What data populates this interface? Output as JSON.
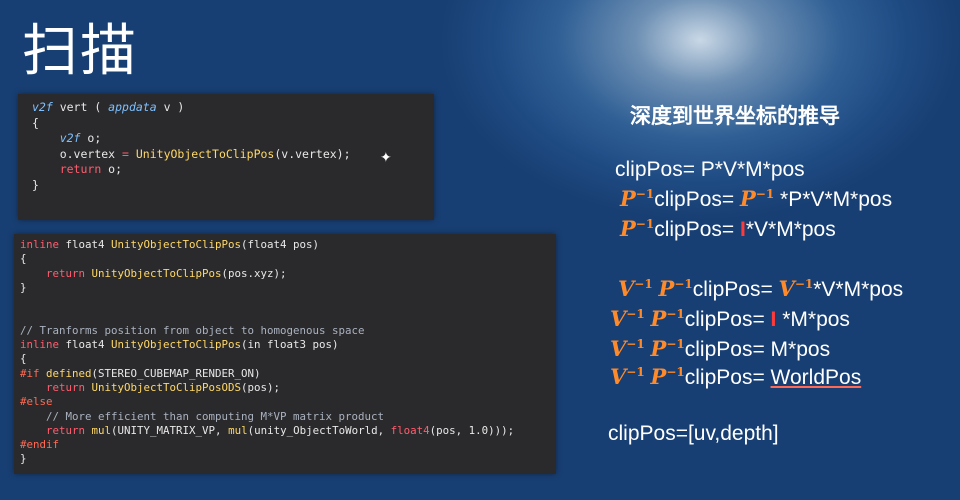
{
  "slide": {
    "title": "扫描",
    "heading": "深度到世界坐标的推导"
  },
  "code1": {
    "l1_type": "v2f",
    "l1_name": " vert ( ",
    "l1_param": "appdata",
    "l1_end": " v )",
    "l2": "{",
    "l3_type": "v2f",
    "l3_rest": " o;",
    "l4_a": "o.vertex ",
    "l4_eq": "=",
    "l4_fn": " UnityObjectToClipPos",
    "l4_end": "(v.vertex);",
    "l5_kw": "return",
    "l5_rest": " o;",
    "l6": "}"
  },
  "code2": {
    "a1_kw": "inline",
    "a1_rest": " float4 ",
    "a1_fn": "UnityObjectToClipPos",
    "a1_end": "(float4 pos)",
    "a2": "{",
    "a3_kw": "return",
    "a3_fn": " UnityObjectToClipPos",
    "a3_end": "(pos.xyz);",
    "a4": "}",
    "b1": "// Tranforms position from object to homogenous space",
    "b2_kw": "inline",
    "b2_rest": " float4 ",
    "b2_fn": "UnityObjectToClipPos",
    "b2_end": "(in float3 pos)",
    "b3": "{",
    "b4_pp": "#if",
    "b4_fn": " defined",
    "b4_end": "(STEREO_CUBEMAP_RENDER_ON)",
    "b5_kw": "return",
    "b5_fn": " UnityObjectToClipPosODS",
    "b5_end": "(pos);",
    "b6_pp": "#else",
    "b7": "// More efficient than computing M*VP matrix product",
    "b8_kw": "return",
    "b8_fn": " mul",
    "b8_mid1": "(UNITY_MATRIX_VP, ",
    "b8_fn2": "mul",
    "b8_mid2": "(unity_ObjectToWorld, ",
    "b8_kw2": "float4",
    "b8_end": "(pos, 1.0)));",
    "b9_pp": "#endif",
    "b10": "}"
  },
  "equations": {
    "e1": "clipPos= P*V*M*pos",
    "p_inv": "P",
    "v_inv": "V",
    "exp": "−1",
    "clip": "clipPos= ",
    "e2_rest": " *P*V*M*pos",
    "e3_mark": "I",
    "e3_rest": "*V*M*pos",
    "e4_rest": "*V*M*pos",
    "e5_mark": "I",
    "e5_rest": " *M*pos",
    "e6_rest": "M*pos",
    "e7_rest": "WorldPos",
    "e8": "clipPos=[uv,depth]"
  }
}
